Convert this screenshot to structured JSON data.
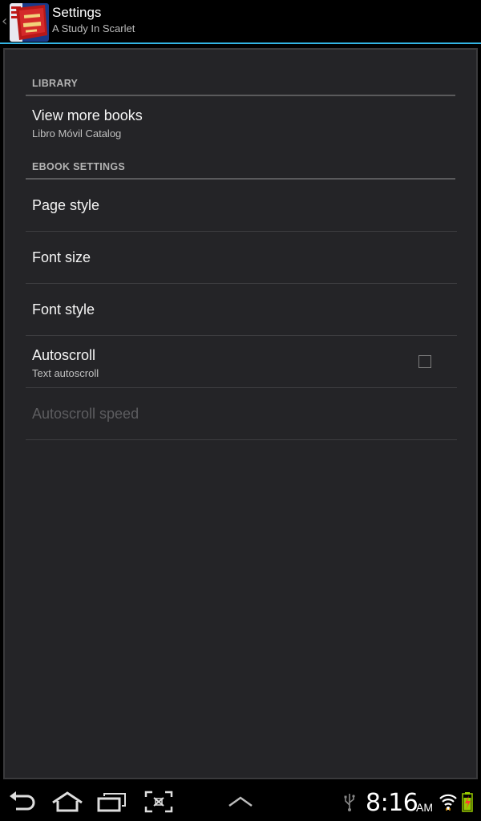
{
  "actionbar": {
    "title": "Settings",
    "subtitle": "A Study In Scarlet",
    "up_glyph": "‹",
    "icon": "book-cover-icon"
  },
  "library": {
    "header": "LIBRARY",
    "items": [
      {
        "title": "View more books",
        "summary": "Libro Móvil Catalog"
      }
    ]
  },
  "ebook": {
    "header": "EBOOK SETTINGS",
    "page_style": {
      "title": "Page style"
    },
    "font_size": {
      "title": "Font size"
    },
    "font_style": {
      "title": "Font style"
    },
    "autoscroll": {
      "title": "Autoscroll",
      "summary": "Text autoscroll",
      "checked": false
    },
    "autoscroll_speed": {
      "title": "Autoscroll speed",
      "enabled": false
    }
  },
  "navbar": {
    "icons": [
      "back-icon",
      "home-icon",
      "recent-apps-icon",
      "screenshot-icon",
      "menu-up-icon"
    ]
  },
  "statusbar": {
    "time": "8:16",
    "ampm": "AM",
    "icons": [
      "usb-icon",
      "wifi-icon",
      "battery-icon"
    ]
  },
  "colors": {
    "accent": "#33b5e5",
    "panel": "#242427",
    "battery": "#99cc00"
  }
}
